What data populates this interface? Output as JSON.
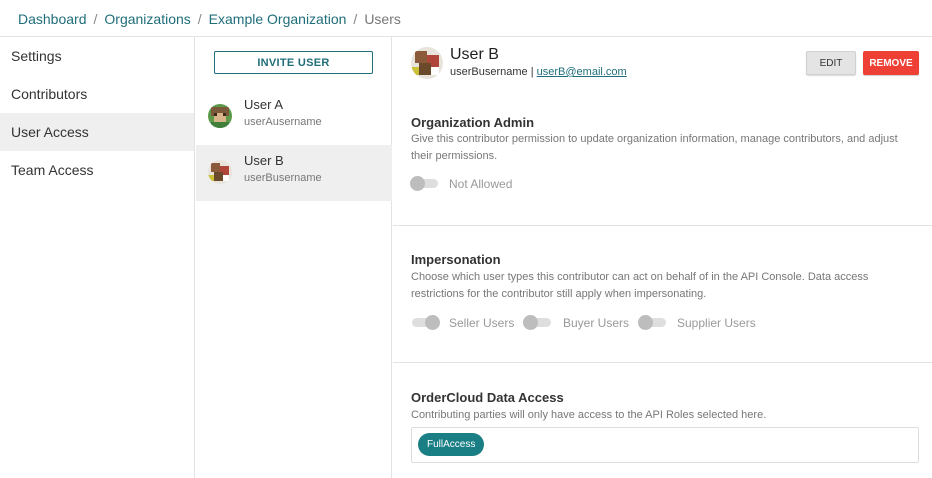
{
  "breadcrumb": {
    "items": [
      "Dashboard",
      "Organizations",
      "Example Organization"
    ],
    "separator": "/",
    "current": "Users"
  },
  "sidebar": {
    "items": [
      {
        "label": "Settings"
      },
      {
        "label": "Contributors"
      },
      {
        "label": "User Access",
        "active": true
      },
      {
        "label": "Team Access"
      }
    ]
  },
  "user_list": {
    "invite_label": "INVITE USER",
    "users": [
      {
        "name": "User A",
        "username": "userAusername",
        "avatar": "pixel-avatar-green"
      },
      {
        "name": "User B",
        "username": "userBusername",
        "avatar": "pixel-avatar-brown",
        "active": true
      }
    ]
  },
  "detail": {
    "name": "User B",
    "username": "userBusername",
    "separator": "|",
    "email": "userB@email.com",
    "edit_label": "EDIT",
    "remove_label": "REMOVE",
    "org_admin": {
      "title": "Organization Admin",
      "description": "Give this contributor permission to update organization information, manage contributors, and adjust their permissions.",
      "toggle_label": "Not Allowed",
      "toggle_on": false
    },
    "impersonation": {
      "title": "Impersonation",
      "description": "Choose which user types this contributor can act on behalf of in the API Console. Data access restrictions for the contributor still apply when impersonating.",
      "options": [
        {
          "label": "Seller Users",
          "on": true
        },
        {
          "label": "Buyer Users",
          "on": false
        },
        {
          "label": "Supplier Users",
          "on": false
        }
      ]
    },
    "data_access": {
      "title": "OrderCloud Data Access",
      "description": "Contributing parties will only have access to the API Roles selected here.",
      "roles": [
        "FullAccess"
      ]
    }
  },
  "colors": {
    "brand": "#1f6e7a",
    "remove": "#ee4034",
    "chip": "#1a7f85",
    "active_bg": "#efefef"
  }
}
